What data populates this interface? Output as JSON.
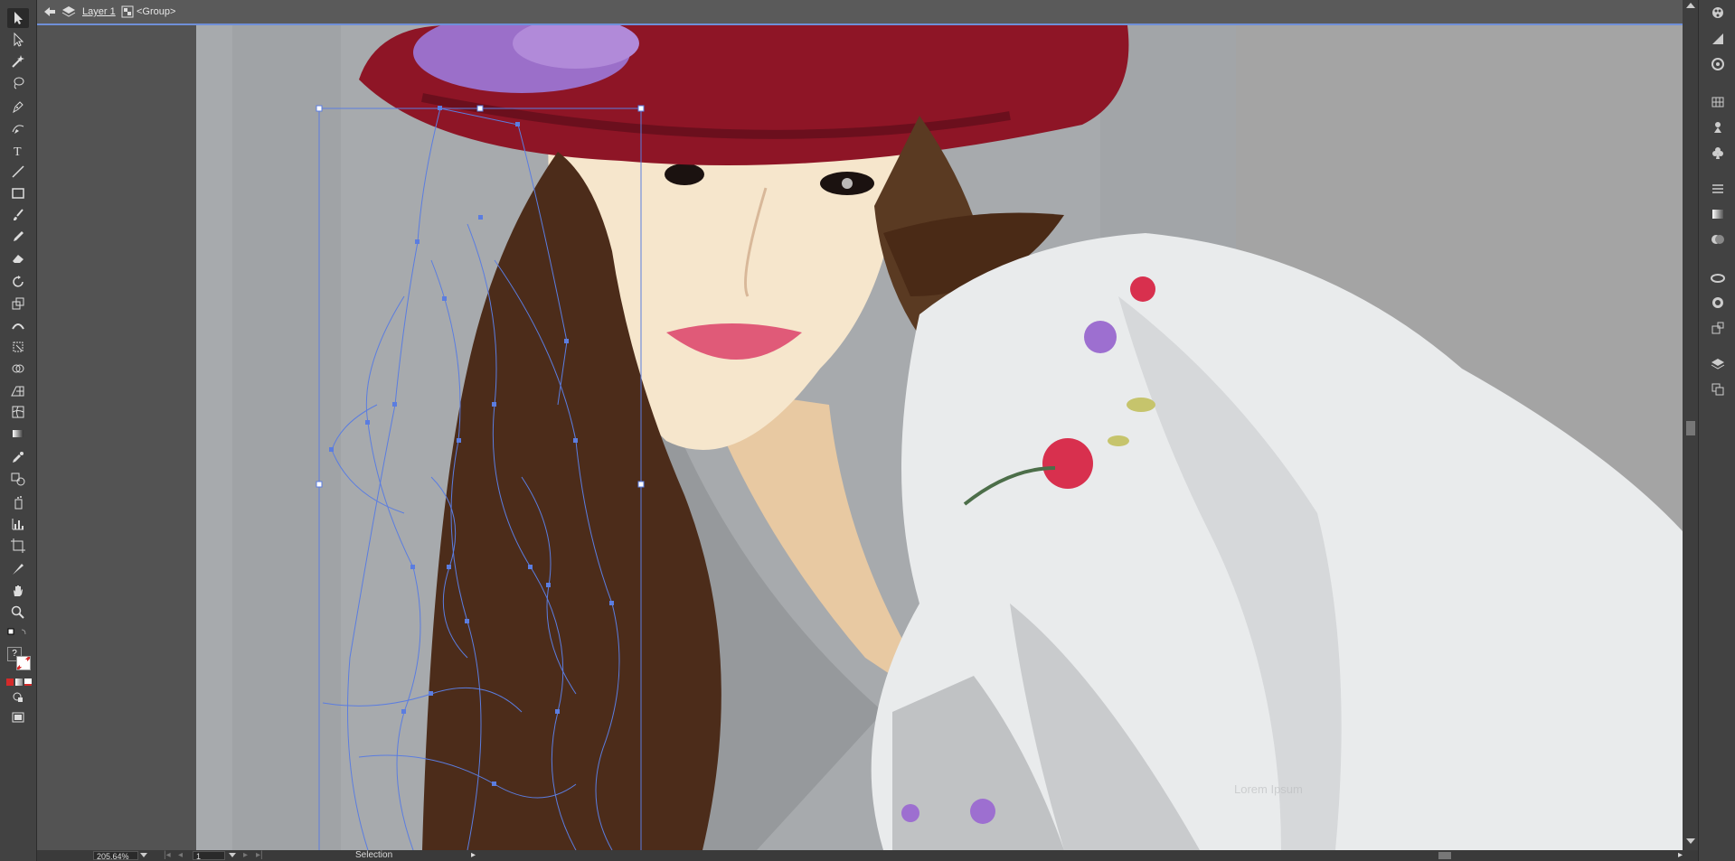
{
  "breadcrumb": {
    "layer": "Layer 1",
    "group": "<Group>"
  },
  "tools": [
    {
      "name": "selection-tool-icon",
      "active": true
    },
    {
      "name": "direct-selection-tool-icon"
    },
    {
      "name": "magic-wand-tool-icon"
    },
    {
      "name": "lasso-tool-icon"
    },
    {
      "name": "pen-tool-icon"
    },
    {
      "name": "curvature-tool-icon"
    },
    {
      "name": "type-tool-icon",
      "glyph": "T"
    },
    {
      "name": "line-segment-tool-icon"
    },
    {
      "name": "rectangle-tool-icon"
    },
    {
      "name": "paintbrush-tool-icon"
    },
    {
      "name": "pencil-tool-icon"
    },
    {
      "name": "eraser-tool-icon"
    },
    {
      "name": "rotate-tool-icon"
    },
    {
      "name": "scale-tool-icon"
    },
    {
      "name": "width-tool-icon"
    },
    {
      "name": "free-transform-tool-icon"
    },
    {
      "name": "shape-builder-tool-icon"
    },
    {
      "name": "perspective-grid-tool-icon"
    },
    {
      "name": "mesh-tool-icon"
    },
    {
      "name": "gradient-tool-icon"
    },
    {
      "name": "eyedropper-tool-icon"
    },
    {
      "name": "blend-tool-icon"
    },
    {
      "name": "symbol-sprayer-tool-icon"
    },
    {
      "name": "column-graph-tool-icon"
    },
    {
      "name": "artboard-tool-icon"
    },
    {
      "name": "slice-tool-icon"
    },
    {
      "name": "hand-tool-icon"
    },
    {
      "name": "zoom-tool-icon"
    }
  ],
  "colors": {
    "fill_indicator": "?",
    "stroke_color": "#d42a2a",
    "selection_blue": "#5b7de0",
    "artboard_bg": "#a6a9ac"
  },
  "right_dock": [
    "color-guide-icon",
    "brushes-icon",
    "appearance-icon",
    "swatches-icon",
    "symbols-icon",
    "club-symbol-icon",
    "stroke-icon",
    "gradient-icon",
    "transparency-icon",
    "creative-cloud-libraries-icon",
    "graphic-styles-icon",
    "transform-icon",
    "layers-icon",
    "artboards-icon"
  ],
  "statusbar": {
    "zoom": "205.64%",
    "artboard_number": "1",
    "tool_name": "Selection"
  },
  "canvas": {
    "watermark": "Lorem Ipsum"
  }
}
